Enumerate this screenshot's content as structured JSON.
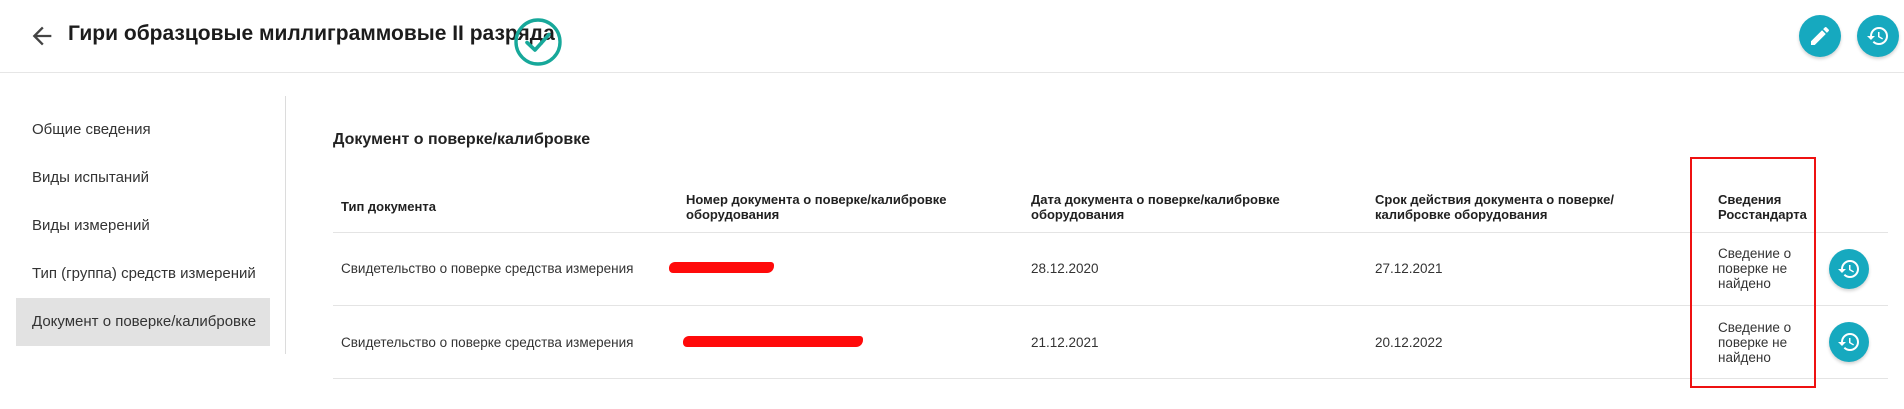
{
  "header": {
    "title": "Гири образцовые миллиграммовые II разряда",
    "icons": {
      "back": "arrow-left-icon",
      "status": "check-circle-icon",
      "edit": "pencil-icon",
      "history": "history-icon"
    },
    "accent_color": "#16a9bf",
    "status_color": "#17a89a"
  },
  "sidebar": {
    "items": [
      {
        "label": "Общие сведения",
        "active": false
      },
      {
        "label": "Виды испытаний",
        "active": false
      },
      {
        "label": "Виды измерений",
        "active": false
      },
      {
        "label": "Тип (группа) средств измерений",
        "active": false
      },
      {
        "label": "Документ о поверке/калибровке",
        "active": true
      }
    ]
  },
  "main": {
    "section_title": "Документ о поверке/калибровке",
    "table": {
      "headers": [
        "Тип документа",
        "Номер документа о поверке/калибровке оборудования",
        "Дата документа о поверке/калибровке оборудования",
        "Срок действия документа о поверке/калибровке оборудования",
        "Сведения Росстандарта"
      ],
      "rows": [
        {
          "type": "Свидетельство о поверке средства измерения",
          "number": "",
          "date": "28.12.2020",
          "valid_until": "27.12.2021",
          "rosstandart": "Сведение о поверке не найдено"
        },
        {
          "type": "Свидетельство о поверке средства измерения",
          "number": "",
          "date": "21.12.2021",
          "valid_until": "20.12.2022",
          "rosstandart": "Сведение о поверке не найдено"
        }
      ]
    },
    "redaction_color": "#ff0a0a",
    "highlight_color": "#ee1111"
  }
}
